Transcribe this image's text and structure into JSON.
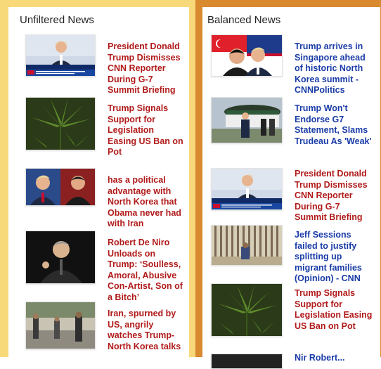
{
  "left": {
    "title": "Unfiltered News",
    "items": [
      {
        "headline": "President Donald Trump Dismisses CNN Reporter During G-7 Summit Briefing",
        "color": "#b11a1a",
        "image": "trump-podium-photo"
      },
      {
        "headline": "Trump Signals Support for Legislation Easing US Ban on Pot",
        "color": "#b11a1a",
        "image": "cannabis-leaf-photo"
      },
      {
        "headline": "has a political advantage with North Korea that Obama never had with Iran",
        "color": "#b11a1a",
        "image": "trump-kim-split-photo"
      },
      {
        "headline": "Robert De Niro Unloads on Trump: ‘Soulless, Amoral, Abusive Con-Artist, Son of a Bitch’",
        "color": "#b11a1a",
        "image": "de-niro-speaking-photo"
      },
      {
        "headline": "Iran, spurned by US, angrily watches Trump-North Korea talks",
        "color": "#b11a1a",
        "image": "street-scene-photo"
      }
    ]
  },
  "right": {
    "title": "Balanced News",
    "items": [
      {
        "headline": "Trump arrives in Singapore ahead of historic North Korea summit - CNNPolitics",
        "color": "#1a3ca8",
        "image": "trump-kim-flags-photo"
      },
      {
        "headline": "Trump Won't Endorse G7 Statement, Slams Trudeau As 'Weak'",
        "color": "#1a3ca8",
        "image": "trump-walking-helicopter-photo"
      },
      {
        "headline": "President Donald Trump Dismisses CNN Reporter During G-7 Summit Briefing",
        "color": "#b11a1a",
        "image": "trump-podium-photo"
      },
      {
        "headline": "Jeff Sessions failed to justify splitting up migrant families (Opinion) - CNN",
        "color": "#1a3ca8",
        "image": "border-fence-photo"
      },
      {
        "headline": "Trump Signals Support for Legislation Easing US Ban on Pot",
        "color": "#b11a1a",
        "image": "cannabis-leaf-photo"
      },
      {
        "headline": "Nir Robert...",
        "color": "#1a3ca8",
        "image": "partial-photo"
      }
    ]
  }
}
